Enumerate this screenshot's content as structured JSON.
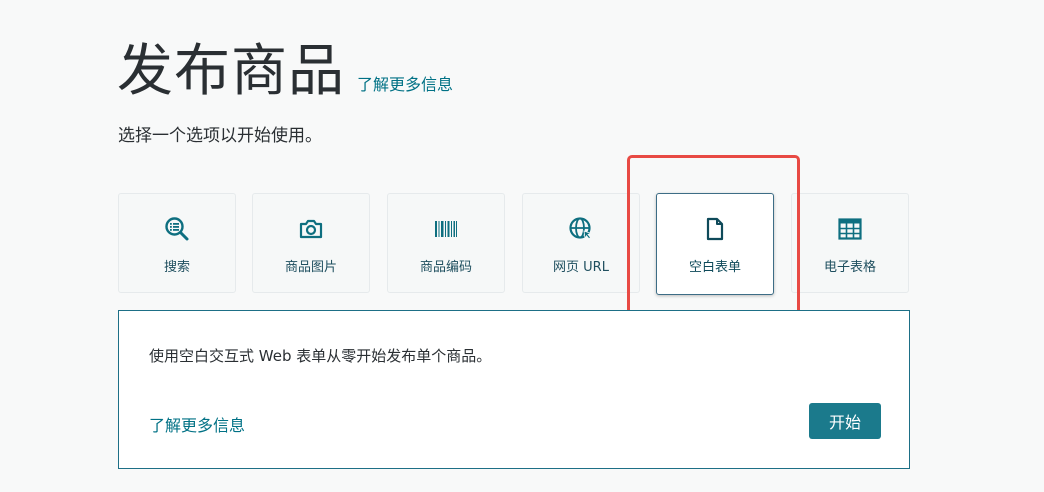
{
  "header": {
    "title": "发布商品",
    "learn_more": "了解更多信息",
    "subtitle": "选择一个选项以开始使用。"
  },
  "options": [
    {
      "label": "搜索",
      "icon": "search-list-icon",
      "selected": false
    },
    {
      "label": "商品图片",
      "icon": "camera-icon",
      "selected": false
    },
    {
      "label": "商品编码",
      "icon": "barcode-icon",
      "selected": false
    },
    {
      "label": "网页 URL",
      "icon": "globe-icon",
      "selected": false
    },
    {
      "label": "空白表单",
      "icon": "document-icon",
      "selected": true
    },
    {
      "label": "电子表格",
      "icon": "spreadsheet-icon",
      "selected": false
    }
  ],
  "panel": {
    "description": "使用空白交互式 Web 表单从零开始发布单个商品。",
    "learn_more": "了解更多信息",
    "start_label": "开始"
  },
  "colors": {
    "accent": "#1b7a8c",
    "link": "#007185",
    "icon": "#0e6f80",
    "highlight": "#e84a44"
  }
}
